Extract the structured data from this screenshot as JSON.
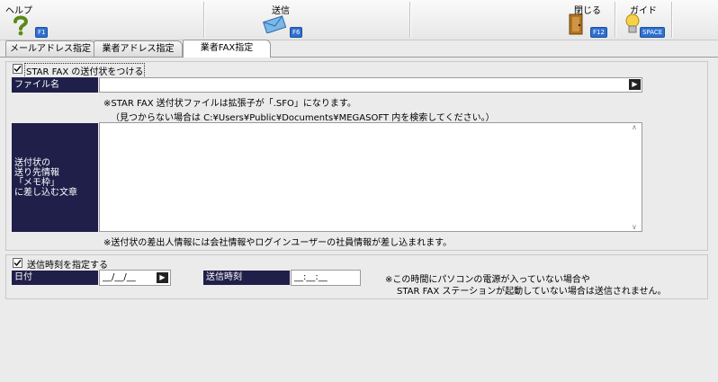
{
  "toolbar": {
    "help_label": "ヘルプ",
    "help_key": "F1",
    "send_label": "送信",
    "send_key": "F6",
    "close_label": "閉じる",
    "close_key": "F12",
    "guide_label": "ガイド",
    "guide_key": "SPACE"
  },
  "tabs": [
    {
      "label": "メールアドレス指定"
    },
    {
      "label": "業者アドレス指定"
    },
    {
      "label": "業者FAX指定"
    }
  ],
  "cover_sheet": {
    "checkbox_label": "STAR FAX の送付状をつける",
    "checked": true,
    "file_label": "ファイル名",
    "file_value": "",
    "note_line1": "※STAR FAX 送付状ファイルは拡張子が「.SFO」になります。",
    "note_line2": "（見つからない場合は C:¥Users¥Public¥Documents¥MEGASOFT 内を検索してください。）",
    "memo_label_lines": [
      "送付状の",
      "送り先情報",
      "「メモ枠」",
      "に差し込む文章"
    ],
    "memo_value": "",
    "bottom_note": "※送付状の差出人情報には会社情報やログインユーザーの社員情報が差し込まれます。"
  },
  "schedule": {
    "checkbox_label": "送信時刻を指定する",
    "checked": true,
    "date_label": "日付",
    "date_value": "__/__/__",
    "time_label": "送信時刻",
    "time_value": "__:__:__",
    "note_line1": "※この時間にパソコンの電源が入っていない場合や",
    "note_line2": "STAR FAX ステーションが起動していない場合は送信されません。"
  }
}
